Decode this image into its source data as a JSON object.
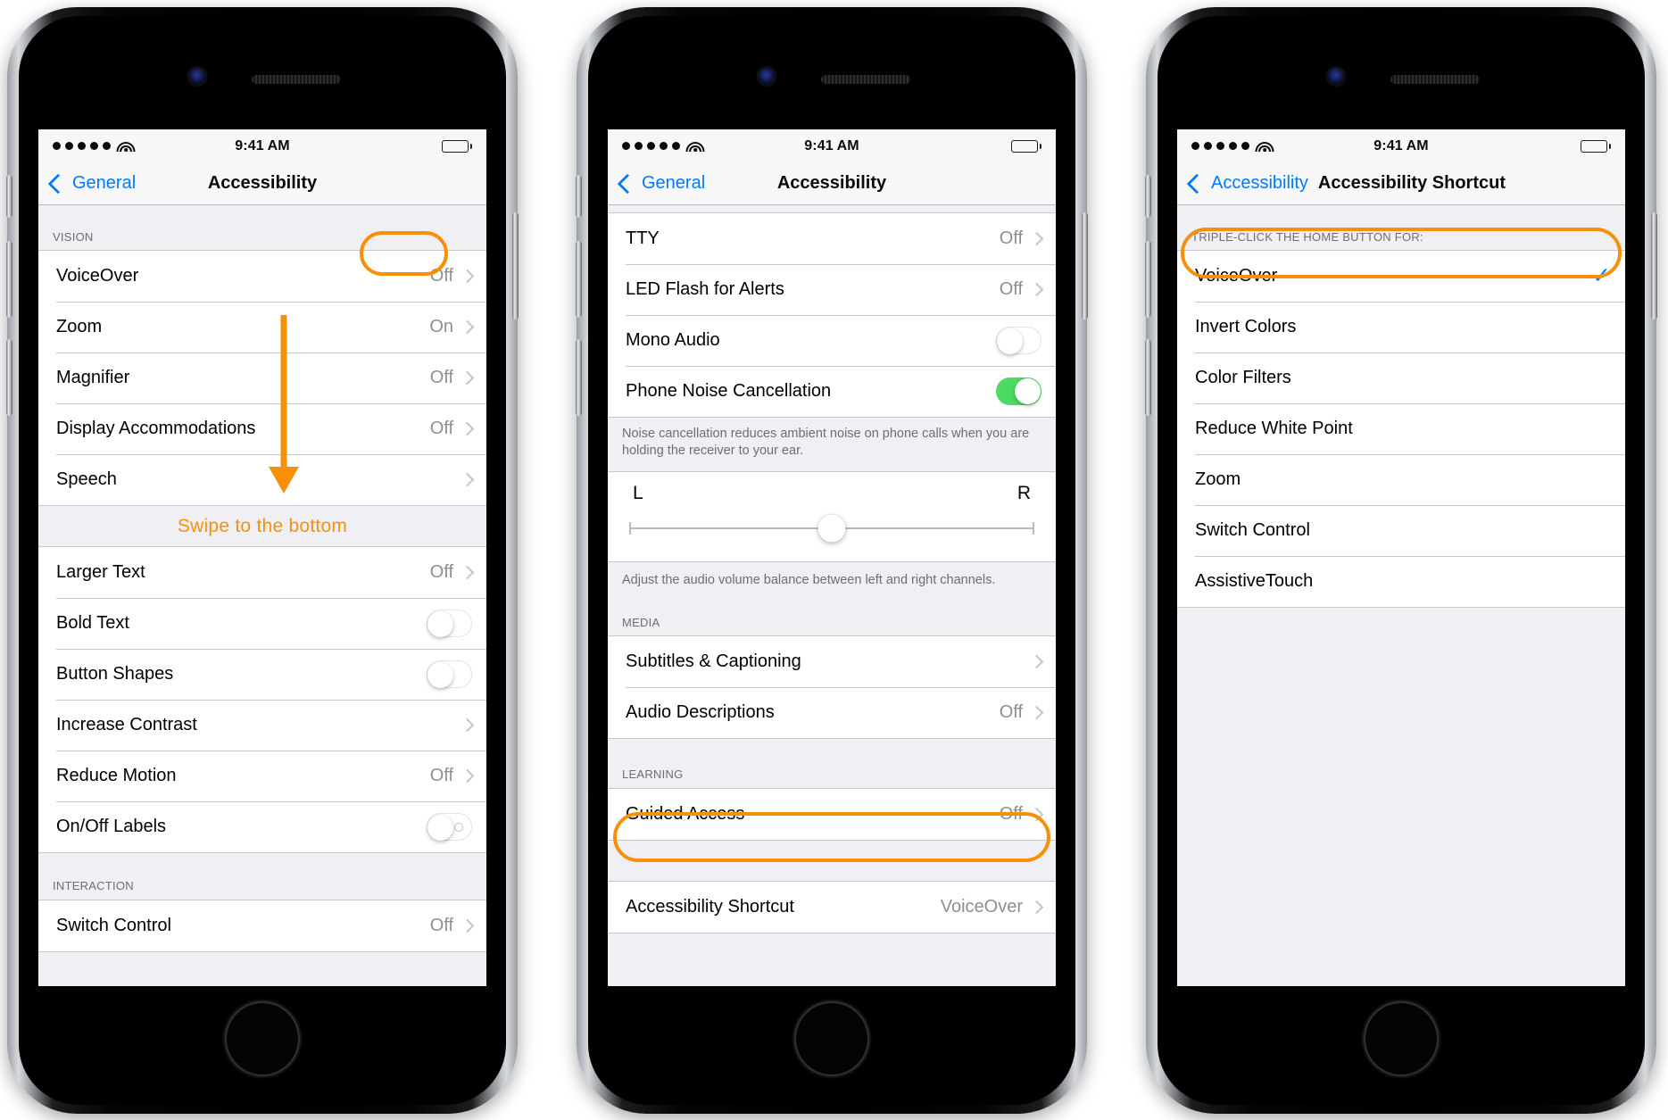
{
  "statusbar": {
    "time": "9:41 AM",
    "signal_dots": 5,
    "wifi_icon": "wifi-icon",
    "battery_icon": "battery-full-icon"
  },
  "annotation": {
    "swipe_text": "Swipe to the bottom",
    "accent_color": "#f79009",
    "arrow_icon": "down-arrow-icon"
  },
  "phone1": {
    "nav": {
      "back_label": "General",
      "title": "Accessibility",
      "back_icon": "chevron-left-icon"
    },
    "group1_header": "VISION",
    "group1_rows": [
      {
        "label": "VoiceOver",
        "value": "Off",
        "accessory": "chevron",
        "highlight": true
      },
      {
        "label": "Zoom",
        "value": "On",
        "accessory": "chevron"
      },
      {
        "label": "Magnifier",
        "value": "Off",
        "accessory": "chevron"
      },
      {
        "label": "Display Accommodations",
        "value": "Off",
        "accessory": "chevron"
      },
      {
        "label": "Speech",
        "value": "",
        "accessory": "chevron"
      }
    ],
    "group2_rows": [
      {
        "label": "Larger Text",
        "value": "Off",
        "accessory": "chevron"
      },
      {
        "label": "Bold Text",
        "value": "",
        "accessory": "switch-off"
      },
      {
        "label": "Button Shapes",
        "value": "",
        "accessory": "switch-off"
      },
      {
        "label": "Increase Contrast",
        "value": "",
        "accessory": "chevron"
      },
      {
        "label": "Reduce Motion",
        "value": "Off",
        "accessory": "chevron"
      },
      {
        "label": "On/Off Labels",
        "value": "",
        "accessory": "switch-off-labeled"
      }
    ],
    "group3_header": "INTERACTION",
    "group3_rows": [
      {
        "label": "Switch Control",
        "value": "Off",
        "accessory": "chevron"
      }
    ]
  },
  "phone2": {
    "nav": {
      "back_label": "General",
      "title": "Accessibility",
      "back_icon": "chevron-left-icon"
    },
    "group1_rows": [
      {
        "label": "TTY",
        "value": "Off",
        "accessory": "chevron"
      },
      {
        "label": "LED Flash for Alerts",
        "value": "Off",
        "accessory": "chevron"
      },
      {
        "label": "Mono Audio",
        "value": "",
        "accessory": "switch-off"
      },
      {
        "label": "Phone Noise Cancellation",
        "value": "",
        "accessory": "switch-on"
      }
    ],
    "note1": "Noise cancellation reduces ambient noise on phone calls when you are holding the receiver to your ear.",
    "balance": {
      "left_label": "L",
      "right_label": "R",
      "position_percent": 50
    },
    "note2": "Adjust the audio volume balance between left and right channels.",
    "group2_header": "MEDIA",
    "group2_rows": [
      {
        "label": "Subtitles & Captioning",
        "value": "",
        "accessory": "chevron"
      },
      {
        "label": "Audio Descriptions",
        "value": "Off",
        "accessory": "chevron"
      }
    ],
    "group3_header": "LEARNING",
    "group3_rows": [
      {
        "label": "Guided Access",
        "value": "Off",
        "accessory": "chevron"
      }
    ],
    "group4_rows": [
      {
        "label": "Accessibility Shortcut",
        "value": "VoiceOver",
        "accessory": "chevron",
        "highlight": true
      }
    ]
  },
  "phone3": {
    "nav": {
      "back_label": "Accessibility",
      "title": "Accessibility Shortcut",
      "back_icon": "chevron-left-icon"
    },
    "group1_header": "TRIPLE-CLICK THE HOME BUTTON FOR:",
    "group1_rows": [
      {
        "label": "VoiceOver",
        "value": "",
        "accessory": "check",
        "highlight": true
      },
      {
        "label": "Invert Colors",
        "value": "",
        "accessory": "none"
      },
      {
        "label": "Color Filters",
        "value": "",
        "accessory": "none"
      },
      {
        "label": "Reduce White Point",
        "value": "",
        "accessory": "none"
      },
      {
        "label": "Zoom",
        "value": "",
        "accessory": "none"
      },
      {
        "label": "Switch Control",
        "value": "",
        "accessory": "none"
      },
      {
        "label": "AssistiveTouch",
        "value": "",
        "accessory": "none"
      }
    ]
  }
}
